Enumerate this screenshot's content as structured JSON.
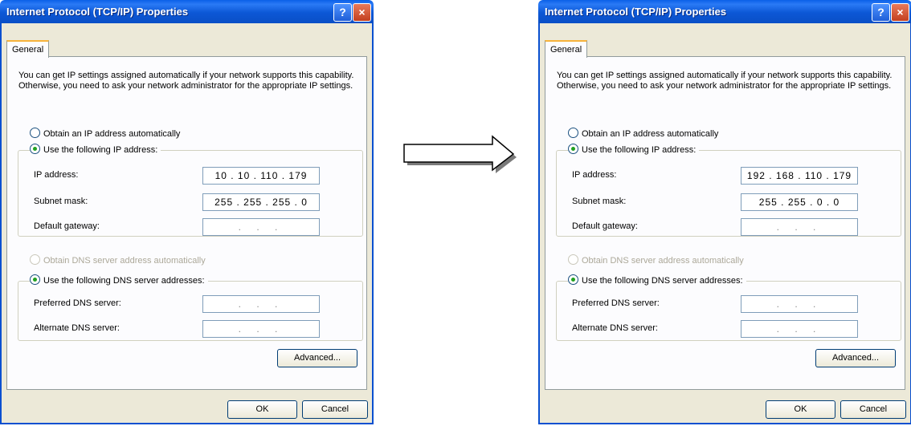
{
  "dialogs": [
    {
      "title": "Internet Protocol (TCP/IP) Properties",
      "help_glyph": "?",
      "close_glyph": "×",
      "tab": "General",
      "intro": "You can get IP settings assigned automatically if your network supports this capability. Otherwise, you need to ask your network administrator for the appropriate IP settings.",
      "obtain_ip_auto": "Obtain an IP address automatically",
      "use_following_ip": "Use the following IP address:",
      "ip_label": "IP address:",
      "ip_value": "10 . 10 . 110 . 179",
      "subnet_label": "Subnet mask:",
      "subnet_value": "255 . 255 . 255 .  0",
      "gateway_label": "Default gateway:",
      "gateway_value": ".  .  .",
      "obtain_dns_auto": "Obtain DNS server address automatically",
      "use_following_dns": "Use the following DNS server addresses:",
      "preferred_dns_label": "Preferred DNS server:",
      "preferred_dns_value": ".  .  .",
      "alternate_dns_label": "Alternate DNS server:",
      "alternate_dns_value": ".  .  .",
      "advanced_button": "Advanced...",
      "ok_button": "OK",
      "cancel_button": "Cancel"
    },
    {
      "title": "Internet Protocol (TCP/IP) Properties",
      "help_glyph": "?",
      "close_glyph": "×",
      "tab": "General",
      "intro": "You can get IP settings assigned automatically if your network supports this capability. Otherwise, you need to ask your network administrator for the appropriate IP settings.",
      "obtain_ip_auto": "Obtain an IP address automatically",
      "use_following_ip": "Use the following IP address:",
      "ip_label": "IP address:",
      "ip_value": "192 . 168 . 110 . 179",
      "subnet_label": "Subnet mask:",
      "subnet_value": "255 . 255 .  0 .  0",
      "gateway_label": "Default gateway:",
      "gateway_value": ".  .  .",
      "obtain_dns_auto": "Obtain DNS server address automatically",
      "use_following_dns": "Use the following DNS server addresses:",
      "preferred_dns_label": "Preferred DNS server:",
      "preferred_dns_value": ".  .  .",
      "alternate_dns_label": "Alternate DNS server:",
      "alternate_dns_value": ".  .  .",
      "advanced_button": "Advanced...",
      "ok_button": "OK",
      "cancel_button": "Cancel"
    }
  ],
  "arrow_icon": "right-arrow-icon"
}
